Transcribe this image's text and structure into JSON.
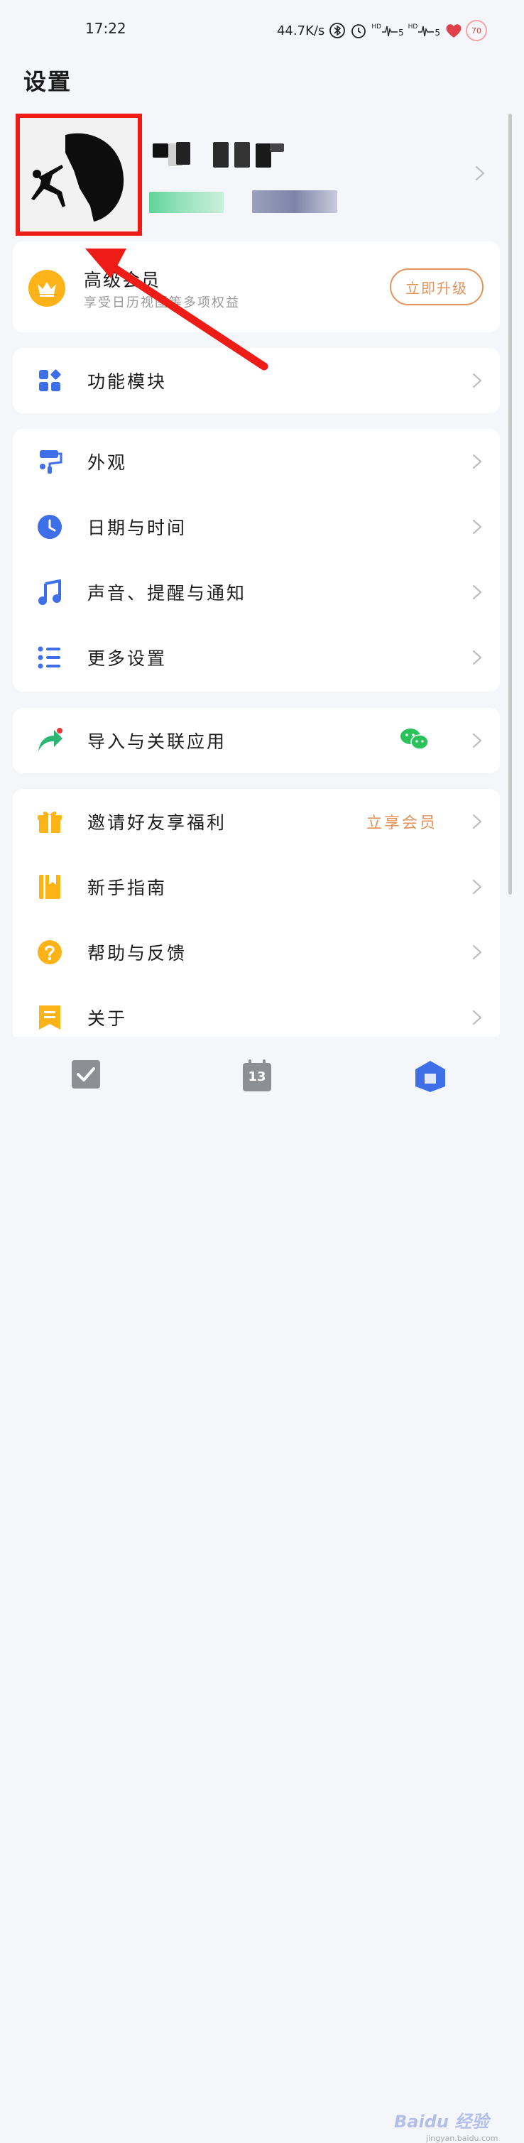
{
  "status_bar": {
    "time": "17:22",
    "network_speed": "44.7K/s",
    "hd_label_1": "HD",
    "signal_1": "5",
    "hd_label_2": "HD",
    "signal_2": "5",
    "battery": "70"
  },
  "page": {
    "title": "设置"
  },
  "profile": {
    "avatar_icon": "climber-avatar",
    "name_hidden": true
  },
  "vip": {
    "title": "高级会员",
    "subtitle": "享受日历视图等多项权益",
    "button_label": "立即升级",
    "icon": "crown-icon"
  },
  "menu": {
    "modules": {
      "label": "功能模块",
      "icon": "grid-icon"
    },
    "appearance": {
      "label": "外观",
      "icon": "paint-roller-icon"
    },
    "datetime": {
      "label": "日期与时间",
      "icon": "clock-icon"
    },
    "sound": {
      "label": "声音、提醒与通知",
      "icon": "music-note-icon"
    },
    "more": {
      "label": "更多设置",
      "icon": "list-icon"
    },
    "import": {
      "label": "导入与关联应用",
      "icon": "share-arrow-icon",
      "extra_icon": "wechat-icon"
    },
    "invite": {
      "label": "邀请好友享福利",
      "extra": "立享会员",
      "icon": "gift-icon"
    },
    "guide": {
      "label": "新手指南",
      "icon": "book-icon"
    },
    "help": {
      "label": "帮助与反馈",
      "icon": "question-icon"
    },
    "about": {
      "label": "关于",
      "icon": "bookmark-icon"
    }
  },
  "tabbar": {
    "tasks_icon": "checkbox-icon",
    "calendar_day": "13",
    "profile_icon": "home-icon"
  },
  "watermark": {
    "text": "Baidu 经验",
    "sub": "jingyan.baidu.com"
  },
  "colors": {
    "accent_blue": "#3f6fe8",
    "accent_orange": "#e6925b",
    "gold": "#fbb318",
    "annotation_red": "#ee1c16",
    "green": "#2bb673"
  }
}
